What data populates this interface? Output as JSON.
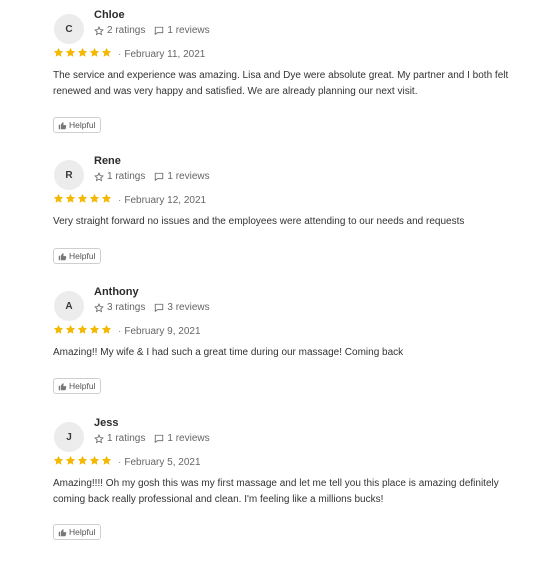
{
  "reviews": [
    {
      "initial": "C",
      "name": "Chloe",
      "ratings": "2 ratings",
      "reviews": "1 reviews",
      "stars": 5,
      "date": "February 11, 2021",
      "text": "The service and experience was amazing. Lisa and Dye were absolute great. My partner and I both felt renewed and was very happy and satisfied. We are already planning our next visit.",
      "helpful_label": "Helpful"
    },
    {
      "initial": "R",
      "name": "Rene",
      "ratings": "1 ratings",
      "reviews": "1 reviews",
      "stars": 5,
      "date": "February 12, 2021",
      "text": "Very straight forward no issues and the employees were attending to our needs and requests",
      "helpful_label": "Helpful"
    },
    {
      "initial": "A",
      "name": "Anthony",
      "ratings": "3 ratings",
      "reviews": "3 reviews",
      "stars": 5,
      "date": "February 9, 2021",
      "text": "Amazing!! My wife & I had such a great time during our massage! Coming back",
      "helpful_label": "Helpful"
    },
    {
      "initial": "J",
      "name": "Jess",
      "ratings": "1 ratings",
      "reviews": "1 reviews",
      "stars": 5,
      "date": "February 5, 2021",
      "text": "Amazing!!!! Oh my gosh this was my first massage and let me tell you this place is amazing definitely coming back really professional and clean. I'm feeling like a millions bucks!",
      "helpful_label": "Helpful"
    }
  ],
  "colors": {
    "star": "#f5b800",
    "avatar_bg": "#ececec"
  },
  "icons": {
    "ratings": "star-outline-icon",
    "reviews": "comment-icon",
    "helpful": "thumbs-up-icon"
  }
}
